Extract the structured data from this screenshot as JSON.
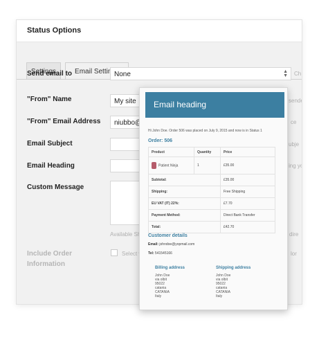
{
  "panel": {
    "title": "Status Options",
    "tabs": [
      {
        "label": "Settings"
      },
      {
        "label": "Email Settings"
      }
    ]
  },
  "form": {
    "send_email_to": {
      "label": "Send email to",
      "value": "None",
      "after": "Ch"
    },
    "from_name": {
      "label": "\"From\" Name",
      "value": "My site",
      "after": "sende"
    },
    "from_email": {
      "label": "\"From\" Email Address",
      "value": "niubbo@",
      "after": "ce"
    },
    "email_subject": {
      "label": "Email Subject",
      "value": "",
      "after": "ubje"
    },
    "email_heading": {
      "label": "Email Heading",
      "value": "",
      "after": "ing you"
    },
    "custom_message": {
      "label": "Custom Message",
      "hint": "Available Sho",
      "after": "dire"
    },
    "include_order": {
      "label_line1": "Include Order",
      "label_line2": "Information",
      "checkbox_text": "Select wh",
      "after": "lor"
    }
  },
  "preview": {
    "heading": "Email heading",
    "intro": "Hi John Doe. Order 506 was placed on July 9, 2015 and now is in Status 1",
    "order_title": "Order: 506",
    "columns": [
      "Product",
      "Quantity",
      "Price"
    ],
    "items": [
      {
        "product": "Patient Ninja",
        "quantity": "1",
        "price": "£35.00"
      }
    ],
    "totals": [
      {
        "label": "Subtotal:",
        "value": "£35.00"
      },
      {
        "label": "Shipping:",
        "value": "Free Shipping"
      },
      {
        "label": "EU VAT (IT) 22%:",
        "value": "£7.70"
      },
      {
        "label": "Payment Method:",
        "value": "Direct Bank Transfer"
      },
      {
        "label": "Total:",
        "value": "£42.70"
      }
    ],
    "customer_title": "Customer details",
    "email_label": "Email:",
    "email_value": "johndoe@yopmail.com",
    "tel_label": "Tel:",
    "tel_value": "541545166",
    "billing": {
      "title": "Billing address",
      "lines": [
        "John Doe",
        "via olbit",
        "95022",
        "catania",
        "CATANIA",
        "Italy"
      ]
    },
    "shipping": {
      "title": "Shipping address",
      "lines": [
        "John Doe",
        "via olbit",
        "95022",
        "catania",
        "CATANIA",
        "Italy"
      ]
    }
  }
}
